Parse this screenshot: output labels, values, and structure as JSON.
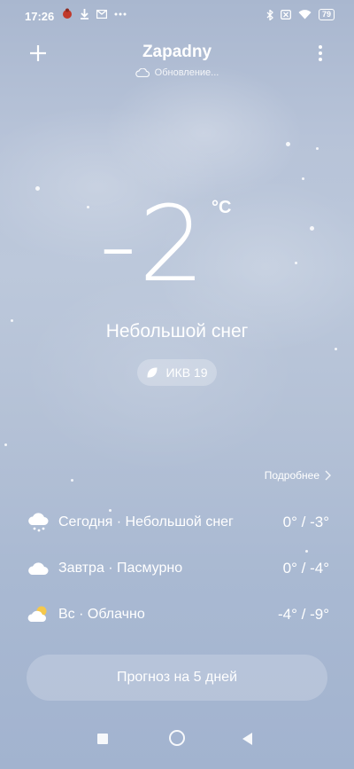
{
  "status_bar": {
    "time": "17:26",
    "battery": "79"
  },
  "header": {
    "city": "Zapadny",
    "update_status": "Обновление..."
  },
  "current": {
    "temperature": "-2",
    "unit": "°C",
    "condition": "Небольшой снег",
    "aqi_label": "ИКВ 19"
  },
  "details_link": "Подробнее",
  "forecast": [
    {
      "label": "Сегодня · Небольшой снег",
      "temps": "0° / -3°",
      "icon": "snow-cloud-icon"
    },
    {
      "label": "Завтра · Пасмурно",
      "temps": "0° / -4°",
      "icon": "cloud-icon"
    },
    {
      "label": "Вс · Облачно",
      "temps": "-4° / -9°",
      "icon": "partly-cloudy-icon"
    }
  ],
  "forecast_button": "Прогноз на 5 дней",
  "colors": {
    "background_top": "#a9b7cf",
    "background_bottom": "#a2b3cf",
    "sun": "#f5c84c"
  }
}
